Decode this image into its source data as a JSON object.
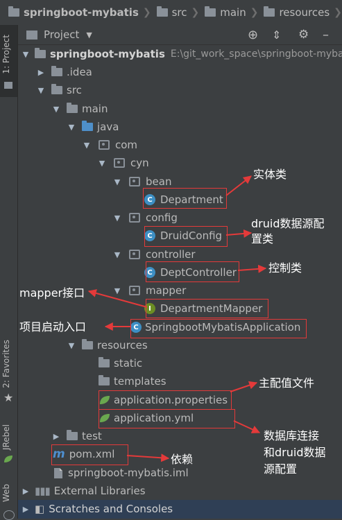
{
  "breadcrumb": [
    "springboot-mybatis",
    "src",
    "main",
    "resources",
    "app"
  ],
  "panel": {
    "title": "Project"
  },
  "side_tabs": {
    "project": "1: Project",
    "favorites": "2: Favorites",
    "jrebel": "JRebel",
    "web": "Web"
  },
  "tree": {
    "root_name": "springboot-mybatis",
    "root_path": "E:\\git_work_space\\springboot-myba",
    "idea": ".idea",
    "src": "src",
    "main": "main",
    "java": "java",
    "com": "com",
    "cyn": "cyn",
    "bean": "bean",
    "department": "Department",
    "config": "config",
    "druid_config": "DruidConfig",
    "controller": "controller",
    "dept_controller": "DeptController",
    "mapper": "mapper",
    "department_mapper": "DepartmentMapper",
    "application": "SpringbootMybatisApplication",
    "resources": "resources",
    "static": "static",
    "templates": "templates",
    "app_properties": "application.properties",
    "app_yml": "application.yml",
    "test": "test",
    "pom": "pom.xml",
    "iml": "springboot-mybatis.iml",
    "ext_libs": "External Libraries",
    "scratches": "Scratches and Consoles"
  },
  "annotations": {
    "entity": "实体类",
    "druid_line1": "druid数据源配",
    "druid_line2": "置类",
    "controller": "控制类",
    "mapper": "mapper接口",
    "startup": "项目启动入口",
    "main_config": "主配值文件",
    "db_line1": "数据库连接",
    "db_line2": "和druid数据",
    "db_line3": "源配置",
    "dependency": "依赖"
  },
  "colors": {
    "annotation_box": "#e43a3a",
    "background": "#3c3f41",
    "class_icon": "#3d8fc4",
    "folder_blue": "#4e8fc9"
  }
}
